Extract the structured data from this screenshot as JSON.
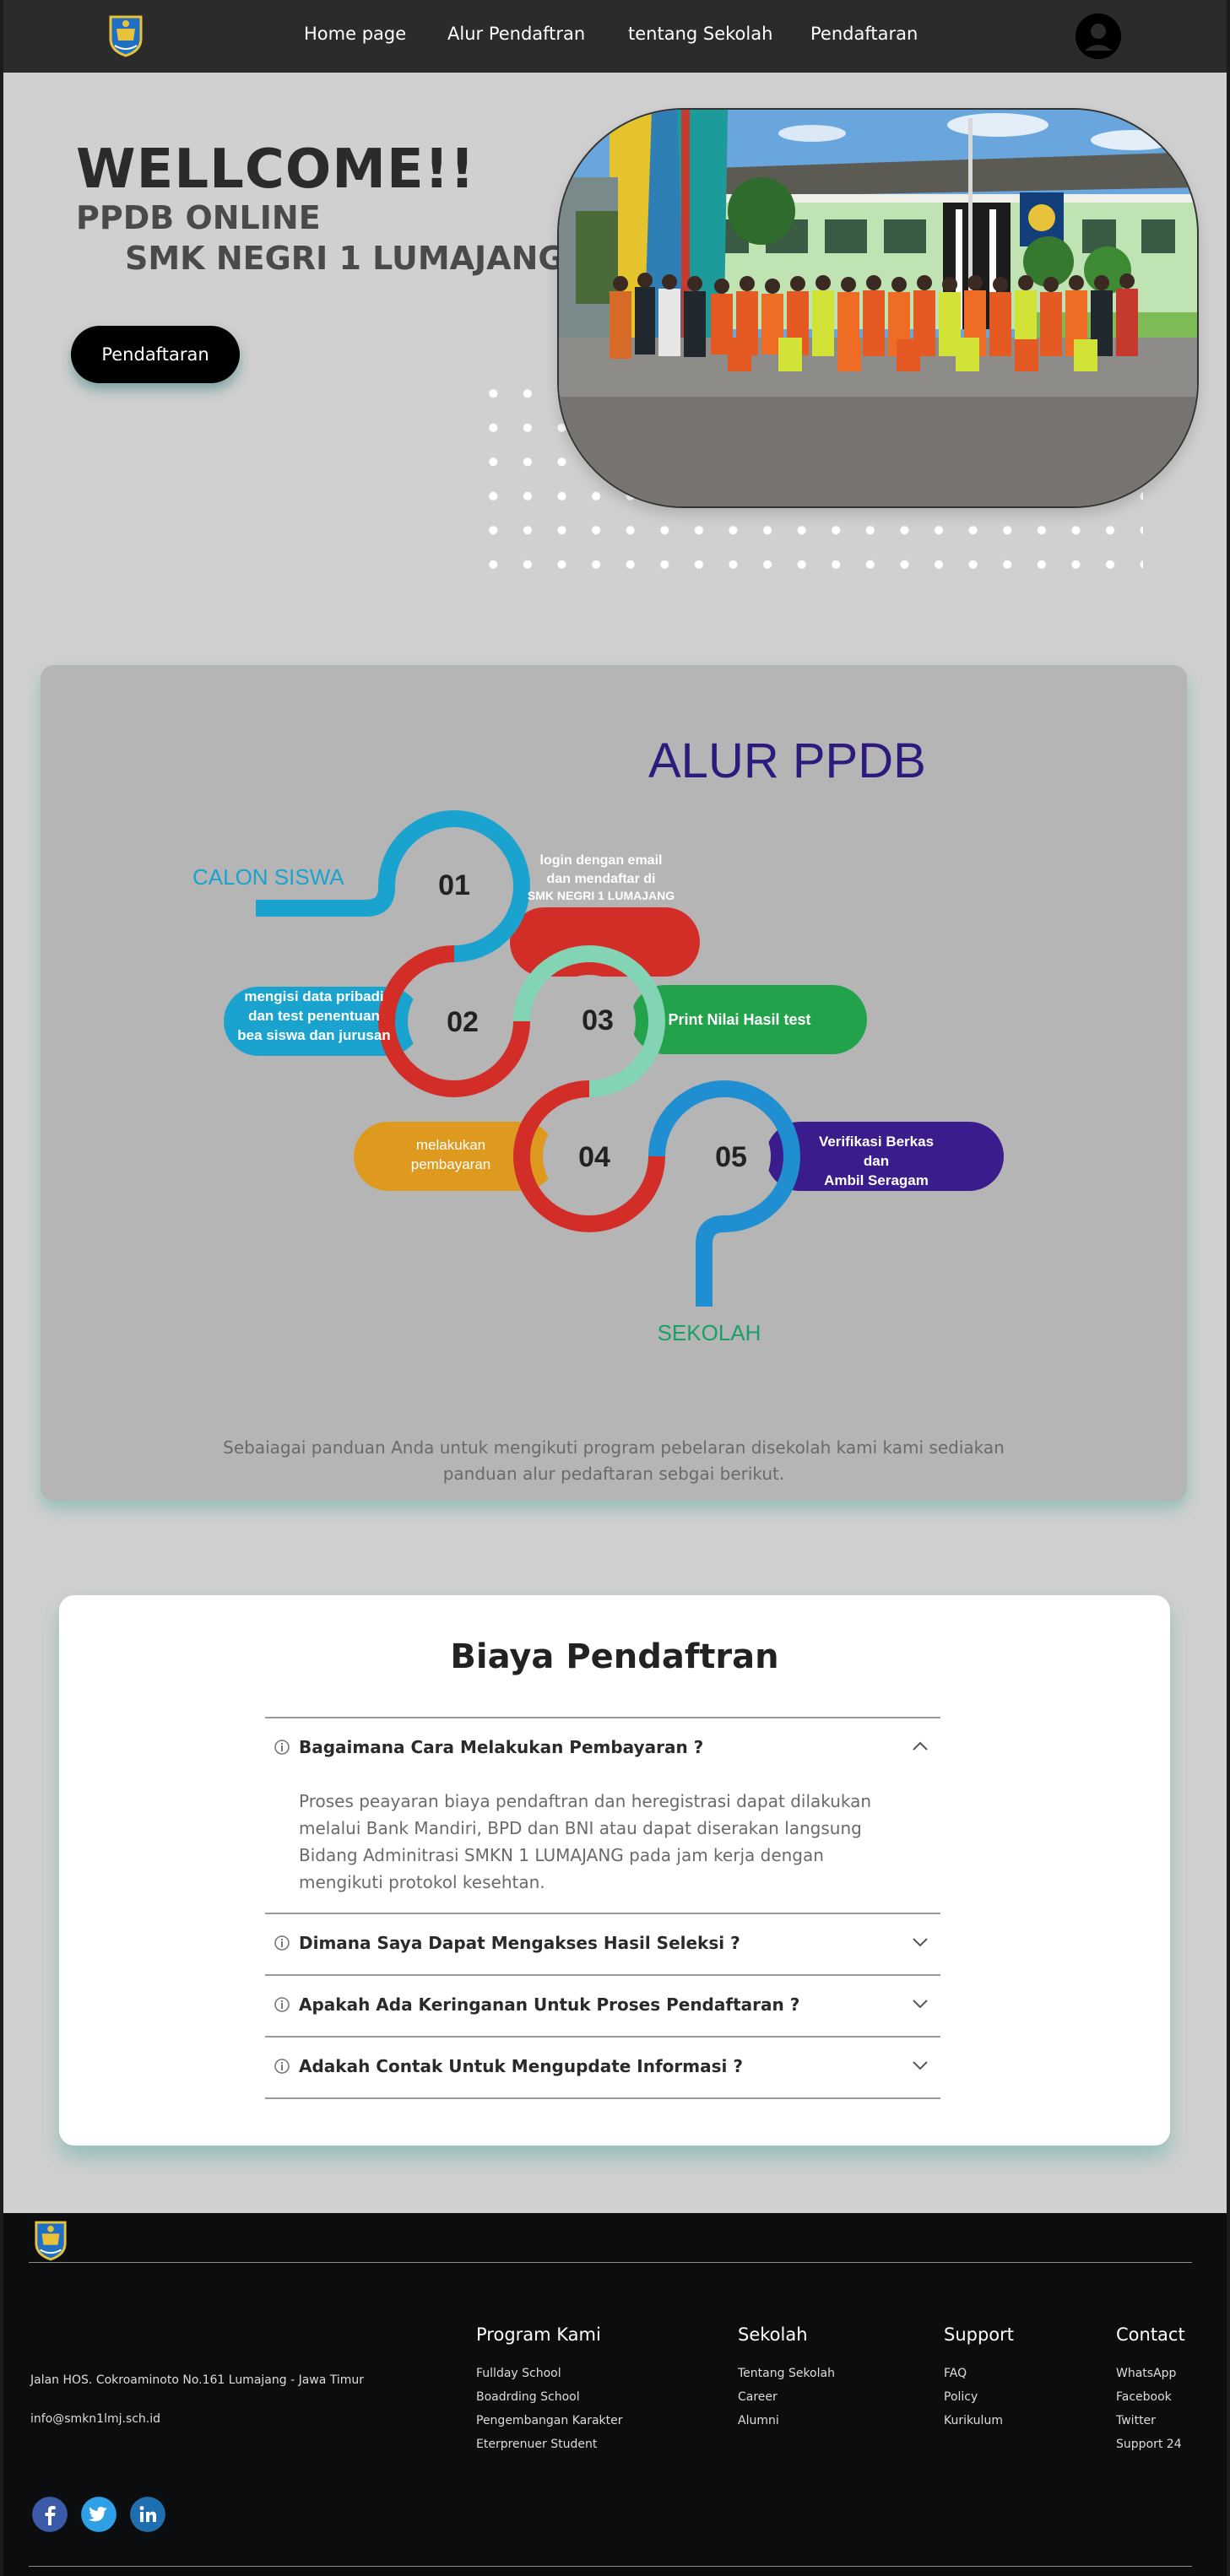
{
  "nav": {
    "links": [
      "Home page",
      "Alur  Pendaftran",
      "tentang Sekolah",
      "Pendaftaran"
    ]
  },
  "hero": {
    "title": "WELLCOME!!",
    "subtitle_1": "PPDB ONLINE",
    "subtitle_2": "SMK NEGRI 1 LUMAJANG",
    "button_label": "Pendaftaran"
  },
  "alur": {
    "title": "ALUR PPDB",
    "start_label": "CALON SISWA",
    "end_label": "SEKOLAH",
    "steps": [
      {
        "number": "01",
        "line1": "login dengan email",
        "line2": "dan mendaftar di",
        "line3": "SMK NEGRI 1 LUMAJANG",
        "color": "#d32d27"
      },
      {
        "number": "02",
        "line1": "mengisi data pribadi",
        "line2": "dan test penentuan",
        "line3": "bea siswa dan jurusan",
        "color": "#1aa3cf"
      },
      {
        "number": "03",
        "line1": "Print Nilai Hasil test",
        "color": "#22a24a"
      },
      {
        "number": "04",
        "line1": "melakukan",
        "line2": "pembayaran",
        "color": "#dd9a1e"
      },
      {
        "number": "05",
        "line1": "Verifikasi Berkas",
        "line2": "dan",
        "line3": "Ambil Seragam",
        "color": "#3a1c8c"
      }
    ],
    "description": "Sebaiagai panduan Anda untuk mengikuti program pebelaran disekolah kami kami sediakan panduan alur pedaftaran sebgai berikut."
  },
  "biaya": {
    "title": "Biaya Pendaftran",
    "faqs": [
      {
        "question": "Bagaimana Cara  Melakukan  Pembayaran ?",
        "answer": "Proses peayaran biaya pendaftran dan heregistrasi dapat dilakukan melalui Bank Mandiri, BPD  dan BNI atau dapat diserakan langsung Bidang Adminitrasi  SMKN 1 LUMAJANG pada jam kerja dengan mengikuti protokol kesehtan.",
        "expanded": true
      },
      {
        "question": "Dimana  Saya Dapat Mengakses  Hasil Seleksi   ?",
        "expanded": false
      },
      {
        "question": "Apakah  Ada Keringanan Untuk Proses Pendaftaran   ?",
        "expanded": false
      },
      {
        "question": "Adakah Contak Untuk Mengupdate Informasi   ?",
        "expanded": false
      }
    ]
  },
  "footer": {
    "address": "Jalan HOS. Cokroaminoto No.161 Lumajang - Jawa Timur",
    "email": "info@smkn1lmj.sch.id",
    "columns": [
      {
        "title": "Program Kami",
        "items": [
          "Fullday School",
          "Boadrding School",
          "Pengembangan Karakter",
          "Eterprenuer Student"
        ]
      },
      {
        "title": "Sekolah",
        "items": [
          "Tentang Sekolah",
          "Career",
          "Alumni"
        ]
      },
      {
        "title": "Support",
        "items": [
          "FAQ",
          "Policy",
          "Kurikulum"
        ]
      },
      {
        "title": "Contact",
        "items": [
          "WhatsApp",
          "Facebook",
          "Twitter",
          "Support 24"
        ]
      }
    ],
    "social": [
      "facebook-icon",
      "twitter-icon",
      "linkedin-icon"
    ]
  }
}
